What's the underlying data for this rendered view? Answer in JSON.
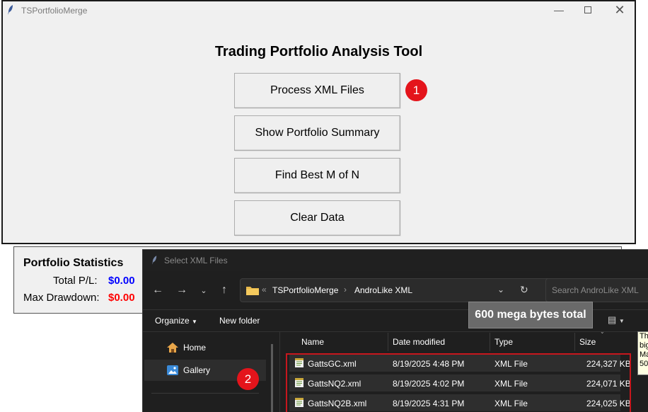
{
  "main_window": {
    "title": "TSPortfolioMerge",
    "heading": "Trading Portfolio Analysis Tool",
    "buttons": [
      "Process XML Files",
      "Show Portfolio Summary",
      "Find Best M of N",
      "Clear Data"
    ],
    "controls": [
      "minimize-icon",
      "maximize-icon",
      "close-icon"
    ]
  },
  "annotations": {
    "badge_1": "1",
    "badge_2": "2",
    "badge_color": "#e4141b",
    "tooltip": "600 mega bytes total"
  },
  "stats": {
    "title": "Portfolio Statistics",
    "total_pl_label": "Total P/L:",
    "total_pl_value": "$0.00",
    "total_pl_color": "#0000ff",
    "max_dd_label": "Max Drawdown:",
    "max_dd_value": "$0.00",
    "max_dd_color": "#ff0000"
  },
  "dialog": {
    "title": "Select XML Files",
    "breadcrumb_overflow": "«",
    "breadcrumb": [
      "TSPortfolioMerge",
      "AndroLike XML"
    ],
    "search_placeholder": "Search AndroLike XML",
    "toolbar": {
      "organize": "Organize",
      "new_folder": "New folder"
    },
    "nav": [
      {
        "label": "Home",
        "icon": "home-icon"
      },
      {
        "label": "Gallery",
        "icon": "gallery-icon",
        "selected": true
      }
    ],
    "columns": [
      "Name",
      "Date modified",
      "Type",
      "Size"
    ],
    "files": [
      {
        "name": "GattsGC.xml",
        "date": "8/19/2025 4:48 PM",
        "type": "XML File",
        "size": "224,327 KB"
      },
      {
        "name": "GattsNQ2.xml",
        "date": "8/19/2025 4:02 PM",
        "type": "XML File",
        "size": "224,071 KB"
      },
      {
        "name": "GattsNQ2B.xml",
        "date": "8/19/2025 4:31 PM",
        "type": "XML File",
        "size": "224,025 KB"
      }
    ]
  },
  "side_tooltip": [
    "Th",
    "big",
    "Ma",
    "50"
  ]
}
